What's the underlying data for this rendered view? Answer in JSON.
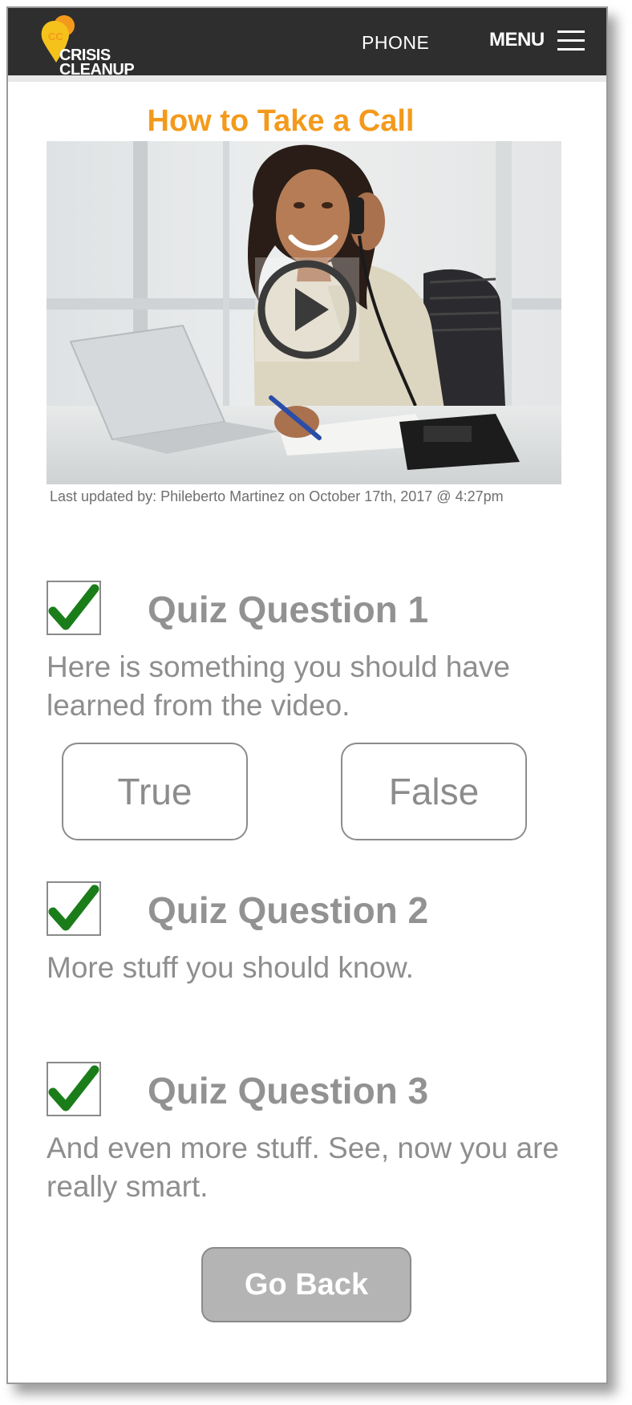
{
  "header": {
    "logo_line1": "CRISIS",
    "logo_line2": "CLEANUP",
    "phone_label": "PHONE",
    "menu_label": "MENU"
  },
  "page": {
    "title": "How to Take a Call",
    "last_updated": "Last updated by: Phileberto Martinez on October 17th, 2017 @ 4:27pm"
  },
  "quiz": [
    {
      "title": "Quiz Question 1",
      "text": "Here is something you should have learned from the video.",
      "checked": true,
      "answers": [
        "True",
        "False"
      ]
    },
    {
      "title": "Quiz Question 2",
      "text": "More stuff you should know.",
      "checked": true
    },
    {
      "title": "Quiz Question 3",
      "text": "And even more stuff.  See, now you are really smart.",
      "checked": true
    }
  ],
  "actions": {
    "go_back_label": "Go Back"
  },
  "colors": {
    "header_bg": "#2e2e2e",
    "title_orange": "#f39a1c",
    "check_green": "#1a7d1a",
    "muted_text": "#8e8e8e",
    "go_back_bg": "#b4b4b4"
  },
  "icons": {
    "logo": "crisis-cleanup-logo",
    "menu": "hamburger-icon",
    "play": "play-icon",
    "check": "checkmark-icon"
  }
}
